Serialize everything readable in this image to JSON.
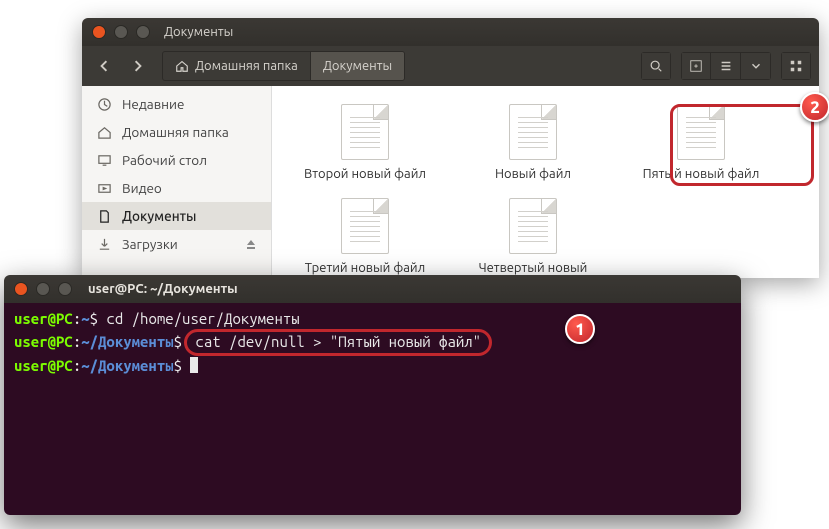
{
  "fm": {
    "title": "Документы",
    "breadcrumb": {
      "home": "Домашняя папка",
      "current": "Документы"
    },
    "sidebar": {
      "items": [
        {
          "label": "Недавние"
        },
        {
          "label": "Домашняя папка"
        },
        {
          "label": "Рабочий стол"
        },
        {
          "label": "Видео"
        },
        {
          "label": "Документы"
        },
        {
          "label": "Загрузки"
        }
      ]
    },
    "files": [
      {
        "label": "Второй новый файл"
      },
      {
        "label": "Новый файл"
      },
      {
        "label": "Пятый новый файл"
      },
      {
        "label": "Третий новый файл"
      },
      {
        "label": "Четвертый новый файл"
      }
    ]
  },
  "term": {
    "title": "user@PC: ~/Документы",
    "prompt_user": "user@PC",
    "prompt_home": "~",
    "prompt_path": "~/Документы",
    "lines": {
      "cd": "cd /home/user/Документы",
      "cat": "cat /dev/null > \"Пятый новый файл\""
    }
  },
  "badges": {
    "one": "1",
    "two": "2"
  }
}
